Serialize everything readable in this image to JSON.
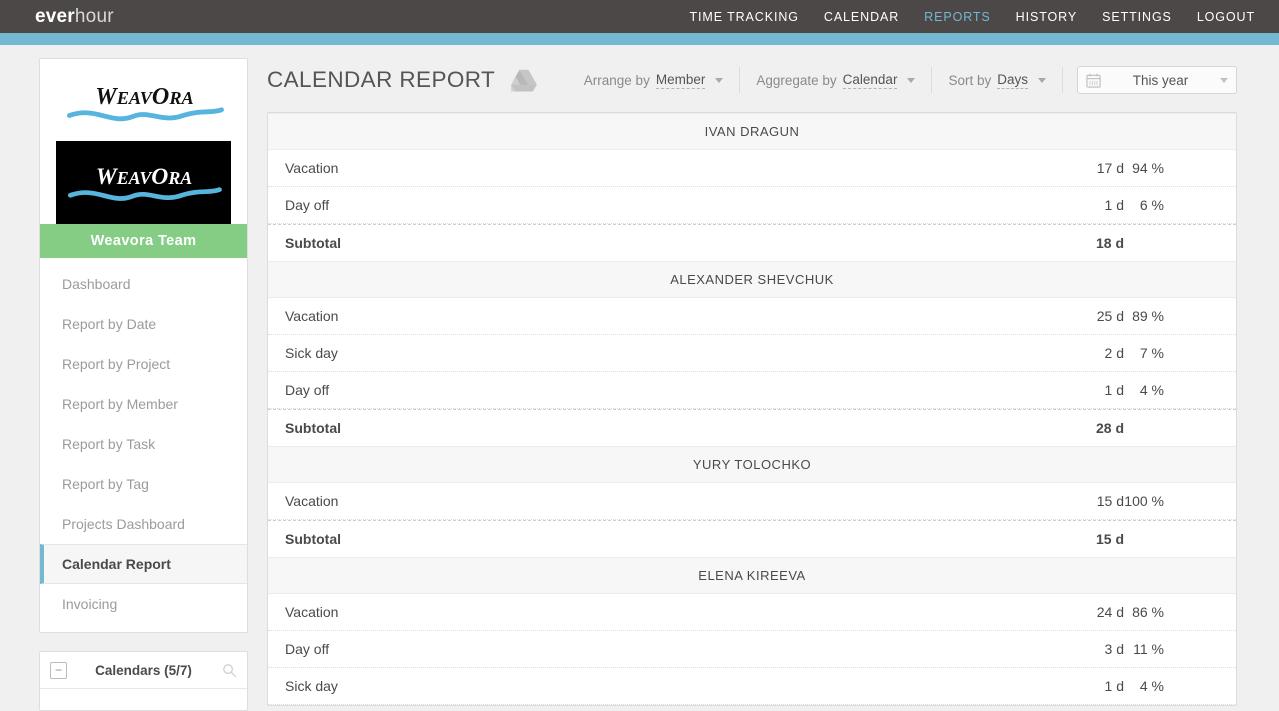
{
  "topbar": {
    "brand_bold": "ever",
    "brand_light": "hour",
    "nav": [
      {
        "label": "TIME TRACKING",
        "active": false
      },
      {
        "label": "CALENDAR",
        "active": false
      },
      {
        "label": "REPORTS",
        "active": true
      },
      {
        "label": "HISTORY",
        "active": false
      },
      {
        "label": "SETTINGS",
        "active": false
      },
      {
        "label": "LOGOUT",
        "active": false
      }
    ],
    "accent_color": "#74b8d1",
    "bar_color": "#4d4848"
  },
  "sidebar": {
    "logo_text": "WEAVORA",
    "team_button": "Weavora Team",
    "team_button_color": "#85cd85",
    "items": [
      {
        "label": "Dashboard",
        "active": false
      },
      {
        "label": "Report by Date",
        "active": false
      },
      {
        "label": "Report by Project",
        "active": false
      },
      {
        "label": "Report by Member",
        "active": false
      },
      {
        "label": "Report by Task",
        "active": false
      },
      {
        "label": "Report by Tag",
        "active": false
      },
      {
        "label": "Projects Dashboard",
        "active": false
      },
      {
        "label": "Calendar Report",
        "active": true
      },
      {
        "label": "Invoicing",
        "active": false
      }
    ],
    "calendars_panel": {
      "title": "Calendars (5/7)",
      "collapse_glyph": "−",
      "search_icon": "search-icon"
    }
  },
  "header": {
    "title": "CALENDAR REPORT",
    "drive_icon": "google-drive-icon"
  },
  "toolbar": {
    "arrange": {
      "label": "Arrange by",
      "value": "Member"
    },
    "aggregate": {
      "label": "Aggregate by",
      "value": "Calendar"
    },
    "sort": {
      "label": "Sort by",
      "value": "Days"
    },
    "date_range": {
      "icon": "calendar-icon",
      "value": "This year"
    }
  },
  "report": {
    "subtotal_label": "Subtotal",
    "groups": [
      {
        "name": "IVAN DRAGUN",
        "rows": [
          {
            "label": "Vacation",
            "days": "17 d",
            "pct": "94 %"
          },
          {
            "label": "Day off",
            "days": "1 d",
            "pct": "6 %"
          }
        ],
        "subtotal": "18 d"
      },
      {
        "name": "ALEXANDER SHEVCHUK",
        "rows": [
          {
            "label": "Vacation",
            "days": "25 d",
            "pct": "89 %"
          },
          {
            "label": "Sick day",
            "days": "2 d",
            "pct": "7 %"
          },
          {
            "label": "Day off",
            "days": "1 d",
            "pct": "4 %"
          }
        ],
        "subtotal": "28 d"
      },
      {
        "name": "YURY TOLOCHKO",
        "rows": [
          {
            "label": "Vacation",
            "days": "15 d",
            "pct": "100 %"
          }
        ],
        "subtotal": "15 d"
      },
      {
        "name": "ELENA KIREEVA",
        "rows": [
          {
            "label": "Vacation",
            "days": "24 d",
            "pct": "86 %"
          },
          {
            "label": "Day off",
            "days": "3 d",
            "pct": "11 %"
          },
          {
            "label": "Sick day",
            "days": "1 d",
            "pct": "4 %"
          }
        ],
        "subtotal": null
      }
    ]
  }
}
